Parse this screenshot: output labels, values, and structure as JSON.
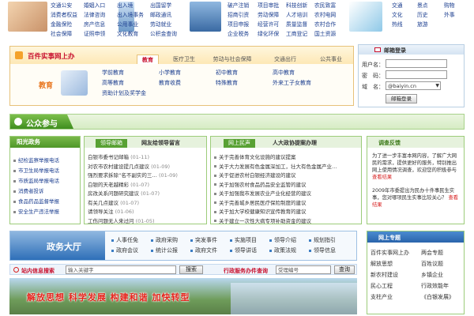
{
  "top_links": {
    "col1": [
      "交通公安",
      "消费者权益",
      "金融保险",
      "社会保障"
    ],
    "col2": [
      "婚姻入口",
      "法律咨询",
      "房产信息",
      "证照申领"
    ],
    "col3": [
      "出入境",
      "出入境事务",
      "公用事业",
      "文化教育"
    ],
    "col4": [
      "出国留学",
      "邮政通讯",
      "劳动就业",
      "公积金查询"
    ],
    "col5": [
      "破产注销",
      "招商引资",
      "项目申报",
      "企业税务"
    ],
    "col6": [
      "项目审批",
      "劳动保障",
      "经营许可",
      "绿化环保"
    ],
    "col7": [
      "科技创新",
      "人才培训",
      "质量监督",
      "工商登记"
    ],
    "col8": [
      "农民致富",
      "农村电网",
      "农村合作",
      "国土资源"
    ],
    "col9": [
      "交通",
      "文化",
      "热线"
    ],
    "col10": [
      "景点",
      "历史",
      "旅游"
    ],
    "col11": [
      "购物",
      "外事"
    ]
  },
  "service": {
    "title": "百件实事网上办",
    "tabs": [
      "教育",
      "医疗卫生",
      "劳动与社会保障",
      "交通出行",
      "公共事业"
    ],
    "active_tab": "教育",
    "category": "教育",
    "links": [
      [
        "学前教育",
        "小学教育",
        "初中教育",
        "高中教育"
      ],
      [
        "高等教育",
        "教育收费",
        "特殊教育",
        "外来工子女教育"
      ],
      [
        "资助计划及奖学金"
      ]
    ]
  },
  "login": {
    "title": "邮箱登录",
    "user_label": "用户名：",
    "password_label": "密　码：",
    "domain_label": "域　名：",
    "domain_value": "@baiyin.cn",
    "submit": "邮箱登录"
  },
  "banner": {
    "title": "公众参与"
  },
  "left_panel": {
    "title": "阳光政务",
    "items": [
      "纪检监察举报电话",
      "市卫生局举报电话",
      "市质监局举报电话",
      "消费者投诉",
      "食品药品监督举报",
      "安全生产违法举报"
    ]
  },
  "mid_panel": {
    "tabs": [
      "领导邮箱",
      "网友给领导留言"
    ],
    "items": [
      {
        "text": "白银市委书记邮箱",
        "date": "(01-11)"
      },
      {
        "text": "对农市农村建设提几点建议",
        "date": "(01-09)"
      },
      {
        "text": "强烈要求拆除“名不副实的三…",
        "date": "(01-09)"
      },
      {
        "text": "白银的天老越精彩",
        "date": "(01-07)"
      },
      {
        "text": "房改关系问题研究建议",
        "date": "(01-07)"
      },
      {
        "text": "有关几点建议",
        "date": "(01-07)"
      },
      {
        "text": "请领导关注",
        "date": "(01-06)"
      },
      {
        "text": "工伤问题无人来过问",
        "date": "(01-05)"
      }
    ]
  },
  "right_panel": {
    "tabs": [
      "网上民声",
      "人大政协提案办理"
    ],
    "items": [
      "关于完善体育文化设施的建议提案",
      "关于大力发展有色金属深加工，壮大有色金属产业…",
      "关于促进农村白银经济建设的建议",
      "关于加强农村食品药品安全监管的建议",
      "关于加强我市发展农业产业化经营的建议",
      "关于完善城乡居民医疗保险制度的建议",
      "关于加大学校健康知识宣传教育的建议",
      "关于建立一次性大病专项补助资金的建议"
    ]
  },
  "survey": {
    "title": "调查反馈",
    "para1": "为了进一步丰富本网内容，了解广大网民的需求，提供更好的服务，特别推出网上使用情况调查，欢迎您的积极参与",
    "link1": "查看结果",
    "para2": "2009年市委提出为民办十件事民生实事，您对哪项民生实事比较关心？",
    "link2": "查看结果"
  },
  "gov_hall": {
    "title": "政务大厅",
    "links": [
      [
        "人事任免",
        "政府采购",
        "突发事件",
        "实施项目",
        "领导介绍",
        "规划指引"
      ],
      [
        "政府会议",
        "统计公报",
        "政府文件",
        "领导讲话",
        "政策法规",
        "领导信息"
      ]
    ]
  },
  "search": {
    "label": "站内信息搜索",
    "placeholder": "输入关键字",
    "button": "搜索",
    "service_label": "行政服务办件查询",
    "service_placeholder": "受理编号",
    "service_button": "查询"
  },
  "slogan": "解放思想 科学发展 构建和谐 加快转型",
  "topic": {
    "title": "网上专题",
    "items": [
      [
        "百件实事网上办",
        "两会专题"
      ],
      [
        "解放思想",
        "百姓议题"
      ],
      [
        "新农村建设",
        "乡镇企业"
      ],
      [
        "民心工程",
        "行政效能年"
      ],
      [
        "支柱产业",
        "《白银发展》"
      ]
    ]
  },
  "colors": {
    "green": "#5aa33a",
    "blue": "#2e6fb8",
    "orange": "#e8731a",
    "red": "#d72020"
  }
}
